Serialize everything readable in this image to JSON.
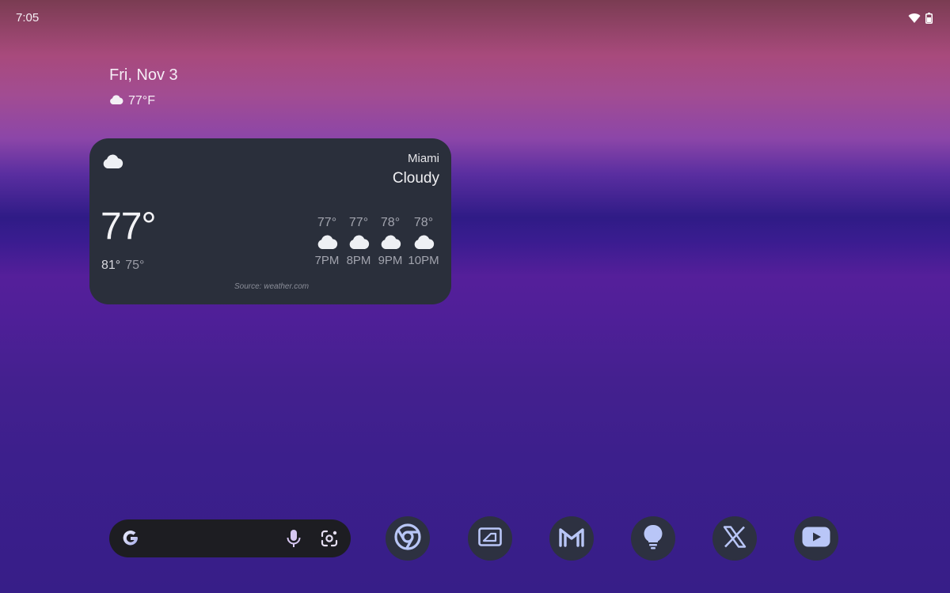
{
  "status_bar": {
    "time": "7:05",
    "icons": [
      "wifi-icon",
      "battery-icon"
    ]
  },
  "glance": {
    "date": "Fri, Nov 3",
    "temperature": "77°F",
    "icon": "cloud-icon"
  },
  "weather_card": {
    "city": "Miami",
    "condition": "Cloudy",
    "current_temp": "77°",
    "high": "81°",
    "low": "75°",
    "source": "Source: weather.com",
    "icon": "cloud-icon",
    "hourly": [
      {
        "temp": "77°",
        "time": "7PM",
        "icon": "cloud-icon"
      },
      {
        "temp": "77°",
        "time": "8PM",
        "icon": "cloud-icon"
      },
      {
        "temp": "78°",
        "time": "9PM",
        "icon": "cloud-icon"
      },
      {
        "temp": "78°",
        "time": "10PM",
        "icon": "cloud-icon"
      }
    ]
  },
  "search_bar": {
    "icons": [
      "google-g-icon",
      "microphone-icon",
      "lens-icon"
    ]
  },
  "dock": {
    "apps": [
      {
        "name": "Chrome",
        "icon": "chrome-icon"
      },
      {
        "name": "Files",
        "icon": "files-icon"
      },
      {
        "name": "Gmail",
        "icon": "gmail-icon"
      },
      {
        "name": "Keep",
        "icon": "lightbulb-icon"
      },
      {
        "name": "X",
        "icon": "x-icon"
      },
      {
        "name": "YouTube",
        "icon": "youtube-icon"
      }
    ]
  },
  "colors": {
    "card_bg": "#2a2f3b",
    "dock_icon_bg": "#2d3141",
    "dock_glyph": "#b9c6f7",
    "search_bg": "#1d1d22"
  }
}
